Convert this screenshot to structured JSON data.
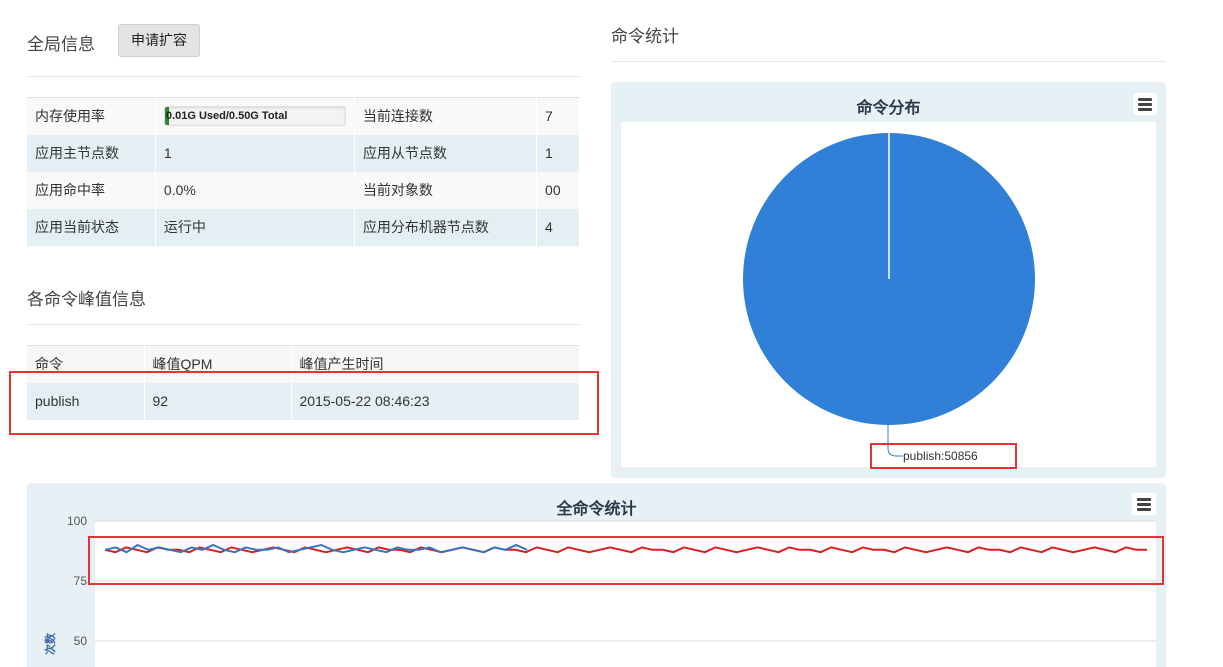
{
  "left": {
    "global_title": "全局信息",
    "apply_button": "申请扩容",
    "info_rows": [
      {
        "label1": "内存使用率",
        "value1": "0.01G  Used/0.50G  Total",
        "label2": "当前连接数",
        "value2": "7"
      },
      {
        "label1": "应用主节点数",
        "value1": "1",
        "label2": "应用从节点数",
        "value2": "1"
      },
      {
        "label1": "应用命中率",
        "value1": "0.0%",
        "label2": "当前对象数",
        "value2": "00"
      },
      {
        "label1": "应用当前状态",
        "value1": "运行中",
        "label2": "应用分布机器节点数",
        "value2": "4"
      }
    ],
    "memory_usage_fraction": 0.02,
    "peak_title": "各命令峰值信息",
    "peak_headers": [
      "命令",
      "峰值QPM",
      "峰值产生时间"
    ],
    "peak_rows": [
      {
        "command": "publish",
        "qpm": "92",
        "time": "2015-05-22 08:46:23"
      }
    ]
  },
  "right": {
    "stats_title": "命令统计",
    "pie_chart": {
      "title": "命令分布",
      "label": "publish:50856"
    }
  },
  "bottom_chart": {
    "title": "全命令统计",
    "ylabel": "次数",
    "y_ticks": [
      "100",
      "75",
      "50"
    ]
  },
  "colors": {
    "pie_blue": "#3080d8",
    "line_red": "#e21c1c",
    "line_blue": "#3a75c4",
    "highlight_red": "#e53333",
    "panel_bg": "#e7f0f5"
  },
  "icons": {
    "chart_menu": "hamburger-menu-icon"
  },
  "chart_data": [
    {
      "type": "pie",
      "title": "命令分布",
      "categories": [
        "publish"
      ],
      "values": [
        50856
      ],
      "legend": "none"
    },
    {
      "type": "line",
      "title": "全命令统计",
      "ylabel": "次数",
      "ylim": [
        50,
        100
      ],
      "grid": true,
      "series": [
        {
          "values": [
            88,
            89,
            87,
            90,
            88,
            89,
            88,
            87,
            89,
            88,
            90,
            88,
            87,
            89,
            88,
            88,
            89,
            87,
            88,
            89,
            90,
            88,
            87,
            88,
            89,
            88,
            87,
            89,
            88,
            88,
            89,
            87,
            88,
            89,
            88,
            87,
            89,
            88,
            90,
            88
          ]
        },
        {
          "values": [
            88,
            87,
            89,
            88,
            87,
            89,
            88,
            88,
            87,
            89,
            88,
            87,
            89,
            88,
            87,
            88,
            89,
            88,
            87,
            89,
            88,
            87,
            88,
            89,
            88,
            87,
            89,
            88,
            88,
            87,
            89,
            88,
            87,
            88,
            89,
            88,
            87,
            89,
            88,
            88,
            87,
            89,
            88,
            87,
            89,
            88,
            87,
            88,
            89,
            88,
            87,
            89,
            88,
            88,
            87,
            89,
            88,
            87,
            89,
            88,
            87,
            88,
            89,
            88,
            87,
            89,
            88,
            88,
            87,
            89,
            88,
            87,
            89,
            88,
            88,
            87,
            89,
            88,
            87,
            88,
            89,
            88,
            87,
            89,
            88,
            88,
            87,
            89,
            88,
            87,
            89,
            88,
            87,
            88,
            89,
            88,
            87,
            89,
            88,
            88
          ]
        }
      ]
    }
  ]
}
